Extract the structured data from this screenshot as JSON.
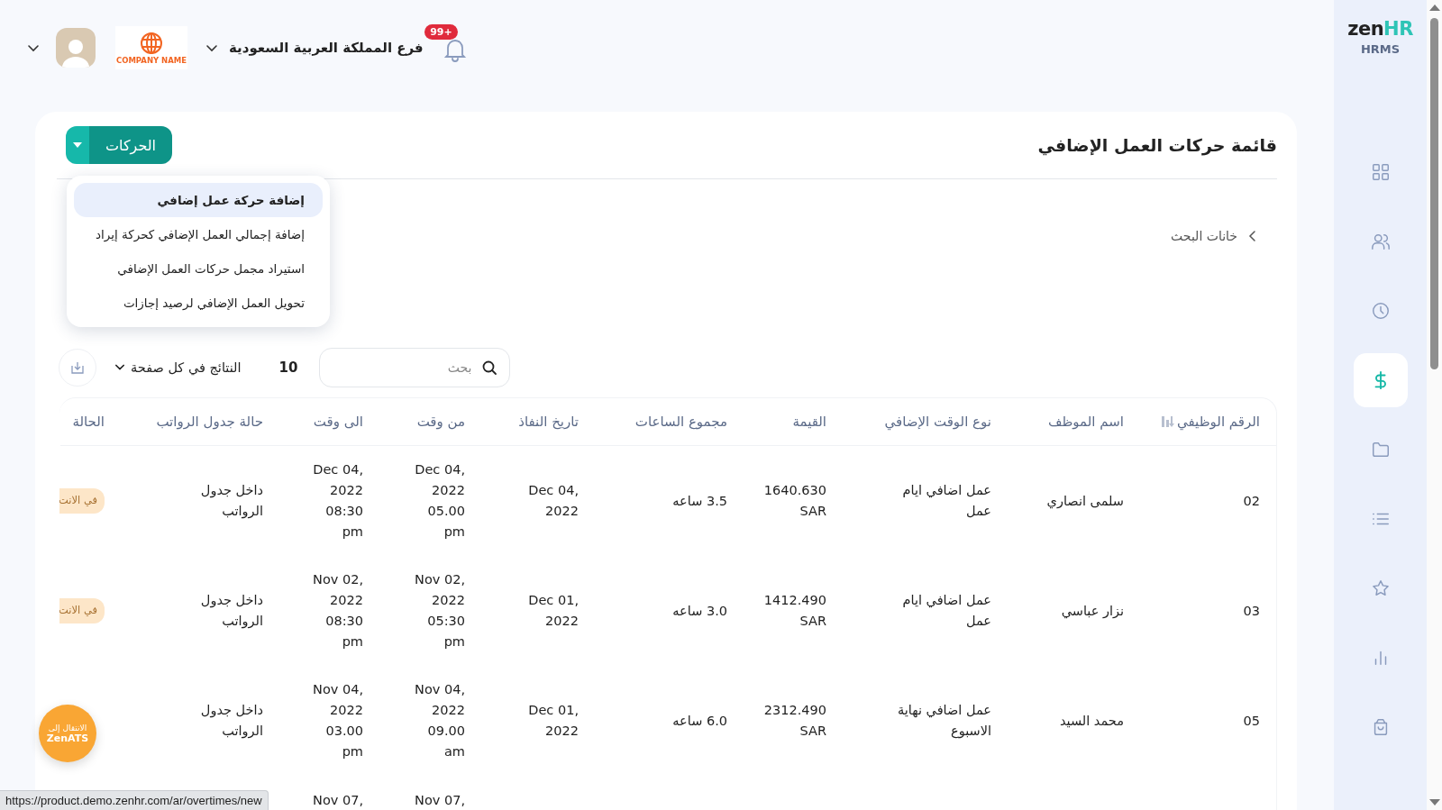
{
  "header": {
    "notifications": {
      "badge": "+99"
    },
    "branch": "فرع المملكة العربية السعودية",
    "company_logo": "COMPANY NAME"
  },
  "sidebar": {
    "logo": {
      "part_1": "zen",
      "part_2": "HR",
      "subtitle": "HRMS"
    },
    "items": [
      {
        "kind": "grid",
        "selected": false
      },
      {
        "kind": "people",
        "selected": false
      },
      {
        "kind": "clock",
        "selected": false
      },
      {
        "kind": "dollar",
        "selected": true
      },
      {
        "kind": "folder",
        "selected": false
      },
      {
        "kind": "list",
        "selected": false
      },
      {
        "kind": "star",
        "selected": false
      },
      {
        "kind": "chart",
        "selected": false
      },
      {
        "kind": "bag",
        "selected": false
      }
    ]
  },
  "card": {
    "title": "قائمة حركات العمل الإضافي",
    "actions_button": "الحركات",
    "actions_menu": [
      {
        "label": "إضافة حركة عمل إضافي",
        "selected": true
      },
      {
        "label": "إضافة إجمالي العمل الإضافي كحركة إيراد",
        "selected": false
      },
      {
        "label": "استيراد مجمل حركات العمل الإضافي",
        "selected": false
      },
      {
        "label": "تحويل العمل الإضافي لرصيد إجازات",
        "selected": false
      }
    ],
    "breadcrumb": "خانات البحث",
    "search": {
      "placeholder": "بحث"
    },
    "page_size": {
      "value": "10",
      "label": "النتائج في كل صفحة"
    }
  },
  "table": {
    "columns": [
      {
        "label": "الرقم الوظيفي",
        "sorted": true
      },
      {
        "label": "اسم الموظف"
      },
      {
        "label": "نوع الوقت الإضافي"
      },
      {
        "label": "القيمة"
      },
      {
        "label": "مجموع الساعات"
      },
      {
        "label": "تاريخ النفاذ"
      },
      {
        "label": "من وقت"
      },
      {
        "label": "الى وقت"
      },
      {
        "label": "حالة جدول الرواتب"
      },
      {
        "label": "الحالة"
      }
    ],
    "rows": [
      {
        "employee_id": "02",
        "employee_name": "سلمى انصاري",
        "overtime_type": "عمل اضافي ايام عمل",
        "value": "1640.630 SAR",
        "hours": "3.5 ساعه",
        "effective_date": "Dec 04, 2022",
        "from_time": "Dec 04, 2022 05.00 pm",
        "to_time": "Dec 04, 2022 08:30 pm",
        "payroll_status": "داخل جدول الرواتب",
        "status": "في الانت"
      },
      {
        "employee_id": "03",
        "employee_name": "نزار عباسي",
        "overtime_type": "عمل اضافي ايام عمل",
        "value": "1412.490 SAR",
        "hours": "3.0 ساعه",
        "effective_date": "Dec 01, 2022",
        "from_time": "Nov 02, 2022 05:30 pm",
        "to_time": "Nov 02, 2022 08:30 pm",
        "payroll_status": "داخل جدول الرواتب",
        "status": "في الانت"
      },
      {
        "employee_id": "05",
        "employee_name": "محمد السيد",
        "overtime_type": "عمل اضافي نهاية الاسبوع",
        "value": "2312.490 SAR",
        "hours": "6.0 ساعه",
        "effective_date": "Dec 01, 2022",
        "from_time": "Nov 04, 2022 09.00 am",
        "to_time": "Nov 04, 2022 03.00 pm",
        "payroll_status": "داخل جدول الرواتب"
      },
      {
        "from_time": "Nov 07,",
        "to_time": "Nov 07,"
      }
    ]
  },
  "zenats_button": {
    "line_1": "الانتقال إلى",
    "line_2": "ZenATS"
  },
  "status_url": "https://product.demo.zenhr.com/ar/overtimes/new"
}
